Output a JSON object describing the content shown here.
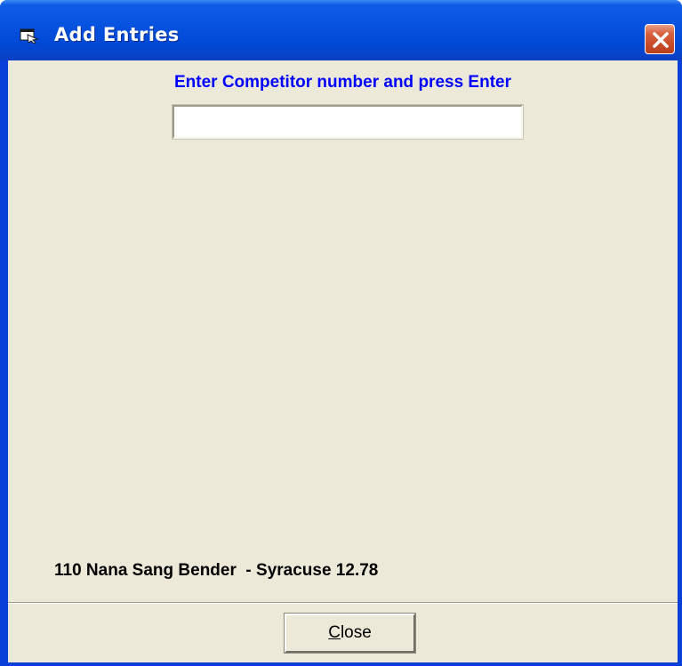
{
  "window": {
    "title": "Add Entries",
    "title_icon": "window-app-icon",
    "close_icon": "close-x-icon",
    "colors": {
      "titlebar": "#0653e0",
      "client_bg": "#ece9d8",
      "close_button": "#d8623f",
      "prompt_text": "#0000ff"
    }
  },
  "form": {
    "prompt": "Enter Competitor number and press Enter",
    "competitor_input_value": "",
    "status_line": "110 Nana Sang Bender  - Syracuse 12.78"
  },
  "footer": {
    "close_label_accel": "C",
    "close_label_rest": "lose"
  }
}
